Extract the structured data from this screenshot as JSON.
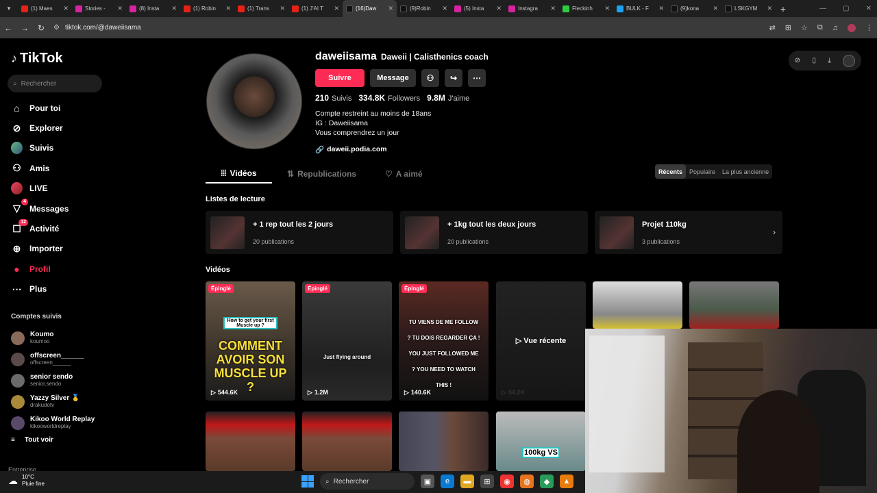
{
  "browser": {
    "tabs": [
      {
        "label": "(1) Maes",
        "icon": "youtube-icon"
      },
      {
        "label": "Stories -",
        "icon": "instagram-icon"
      },
      {
        "label": "(8) Insta",
        "icon": "instagram-icon"
      },
      {
        "label": "(1) Robin",
        "icon": "youtube-icon"
      },
      {
        "label": "(1) Trans",
        "icon": "youtube-icon"
      },
      {
        "label": "(1) J'AI T",
        "icon": "youtube-icon"
      },
      {
        "label": "(16)Daw",
        "icon": "tiktok-icon",
        "active": true
      },
      {
        "label": "(9)Robin",
        "icon": "tiktok-icon"
      },
      {
        "label": "(5) Insta",
        "icon": "instagram-icon"
      },
      {
        "label": "Instagra",
        "icon": "instagram-icon"
      },
      {
        "label": "Fleckinh",
        "icon": "green-site-icon"
      },
      {
        "label": "BULK - F",
        "icon": "blue-site-icon"
      },
      {
        "label": "(9)kona",
        "icon": "tiktok-icon"
      },
      {
        "label": "LSKGYM",
        "icon": "tiktok-icon"
      }
    ],
    "new_tab": "+",
    "url": "tiktok.com/@daweiisama"
  },
  "sidebar": {
    "logo": "TikTok",
    "search_placeholder": "Rechercher",
    "nav": [
      {
        "label": "Pour toi",
        "icon": "home-icon"
      },
      {
        "label": "Explorer",
        "icon": "compass-icon"
      },
      {
        "label": "Suivis",
        "icon": "avatar"
      },
      {
        "label": "Amis",
        "icon": "friends-icon"
      },
      {
        "label": "LIVE",
        "icon": "live-avatar"
      },
      {
        "label": "Messages",
        "icon": "messages-icon",
        "badge": "4"
      },
      {
        "label": "Activité",
        "icon": "activity-icon",
        "badge": "12"
      },
      {
        "label": "Importer",
        "icon": "upload-icon"
      },
      {
        "label": "Profil",
        "icon": "profile-icon",
        "active": true
      },
      {
        "label": "Plus",
        "icon": "more-icon"
      }
    ],
    "followed_title": "Comptes suivis",
    "followed": [
      {
        "name": "Koumo",
        "handle": "koumoo"
      },
      {
        "name": "offscreen______",
        "handle": "offscreen______"
      },
      {
        "name": "senior sendo",
        "handle": "senior.sendo"
      },
      {
        "name": "Yazzy Silver 🥇",
        "handle": "drakudotv"
      },
      {
        "name": "Kikoo World Replay",
        "handle": "kikooworldreplay"
      }
    ],
    "see_all": "Tout voir",
    "footer": "Entreprise"
  },
  "profile": {
    "username": "daweiisama",
    "nickname": "Daweii | Calisthenics coach",
    "follow_label": "Suivre",
    "message_label": "Message",
    "following_count": "210",
    "following_label": "Suivis",
    "followers_count": "334.8K",
    "followers_label": "Followers",
    "likes_count": "9.8M",
    "likes_label": "J'aime",
    "bio": [
      "Compte restreint au moins de 18ans",
      "IG : Daweiisama",
      "Vous comprendrez un jour"
    ],
    "link": "daweii.podia.com"
  },
  "tabs": [
    {
      "label": "Vidéos",
      "active": true
    },
    {
      "label": "Republications"
    },
    {
      "label": "A aimé"
    }
  ],
  "sort": [
    "Récents",
    "Populaire",
    "La plus ancienne"
  ],
  "playlists_title": "Listes de lecture",
  "playlists": [
    {
      "name": "+ 1 rep tout les 2 jours",
      "count": "20 publications"
    },
    {
      "name": "+ 1kg tout les deux jours",
      "count": "20 publications"
    },
    {
      "name": "Projet 110kg",
      "count": "3 publications"
    }
  ],
  "videos_title": "Vidéos",
  "videos": [
    {
      "pinned": "Épinglé",
      "views": "544.6K",
      "overlay": "COMMENT AVOIR SON MUSCLE UP ?",
      "caption": "How to get your first Muscle up ?"
    },
    {
      "pinned": "Épinglé",
      "views": "1.2M",
      "overlay": "Just flying around"
    },
    {
      "pinned": "Épinglé",
      "views": "140.6K",
      "overlay": "TU VIENS DE ME FOLLOW ? TU DOIS REGARDER ÇA ! YOU JUST FOLLOWED ME ? YOU NEED TO WATCH THIS !"
    },
    {
      "recent": "Vue récente",
      "views": "54.2K"
    },
    {},
    {},
    {},
    {},
    {},
    {
      "overlay": "100kg VS"
    }
  ],
  "weather": {
    "temp": "10°C",
    "desc": "Pluie fine"
  },
  "taskbar": {
    "search": "Rechercher"
  },
  "colors": {
    "accent": "#fe2c55",
    "bg": "#000000"
  }
}
